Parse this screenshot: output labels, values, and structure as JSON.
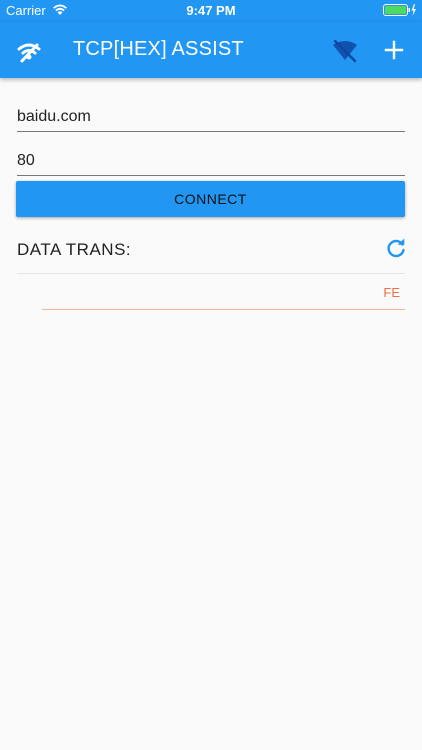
{
  "status_bar": {
    "carrier": "Carrier",
    "time": "9:47 PM",
    "wifi_icon": "wifi-icon",
    "battery_icon": "battery-charging-icon"
  },
  "app_bar": {
    "title": "TCP[HEX] ASSIST",
    "nav_icon": "wifi-tethering-icon",
    "status_icon": "wifi-off-icon",
    "action_icon": "add-icon",
    "color": "#2196f3"
  },
  "form": {
    "host_value": "baidu.com",
    "port_value": "80",
    "connect_label": "CONNECT"
  },
  "data_section": {
    "title": "DATA TRANS:",
    "refresh_icon": "refresh-icon",
    "items": [
      {
        "value": "FE",
        "color": "#ee6f43"
      }
    ]
  }
}
